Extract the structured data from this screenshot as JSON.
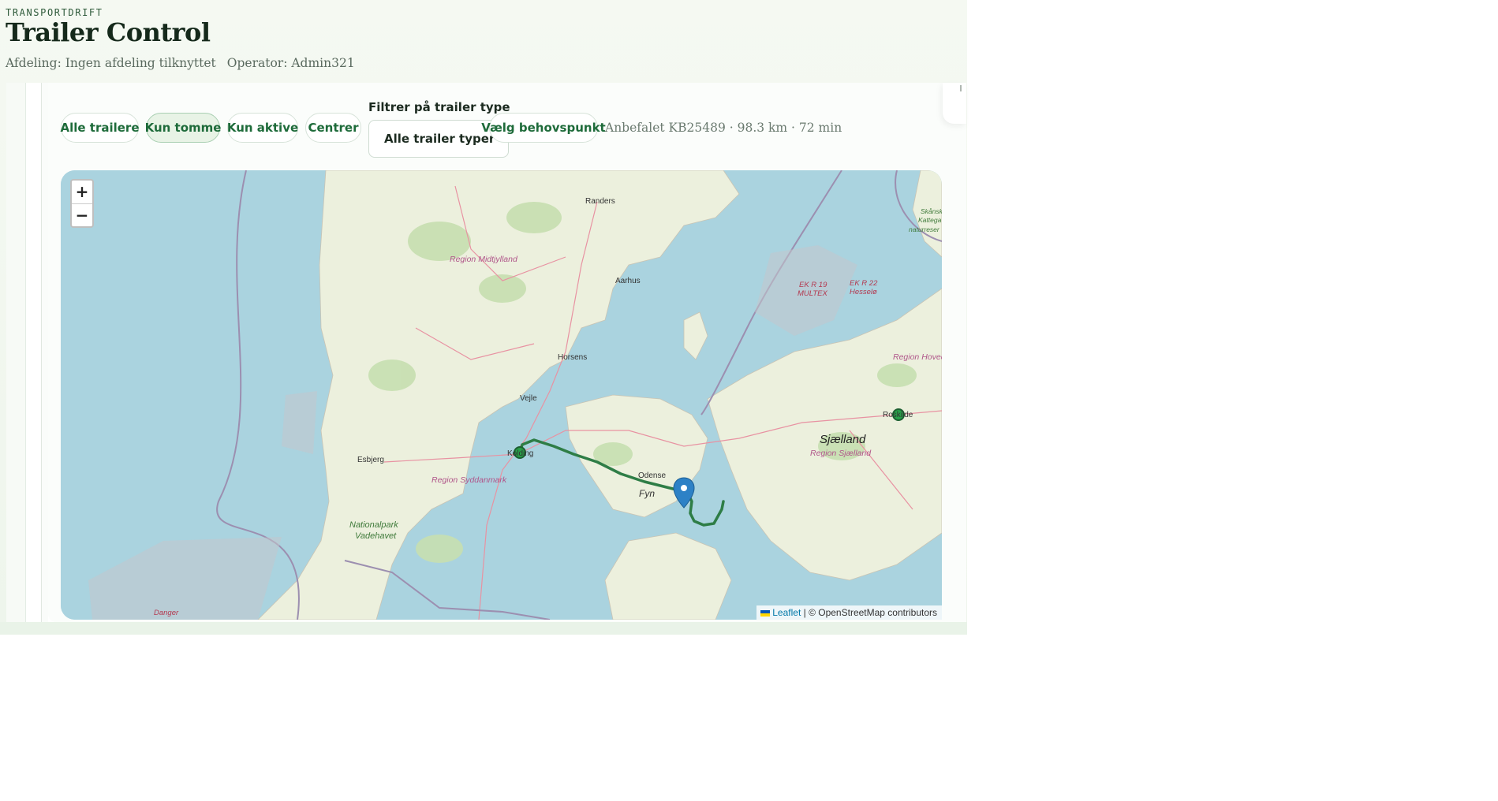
{
  "header": {
    "eyebrow": "TRANSPORTDRIFT",
    "title": "Trailer Control",
    "department": "Afdeling: Ingen afdeling tilknyttet",
    "operator": "Operator: Admin321"
  },
  "toolbar": {
    "chips": {
      "all": "Alle trailere",
      "empty": "Kun tomme",
      "active": "Kun aktive",
      "centers": "Centrer",
      "need_point": "Vælg behovspunkt"
    },
    "active_chip": "empty",
    "filter_label": "Filtrer på trailer type",
    "trailer_type_selected": "Alle trailer typer",
    "recommendation": "Anbefalet KB25489 · 98.3 km · 72 min"
  },
  "map": {
    "zoom_in": "+",
    "zoom_out": "−",
    "attribution_link": "Leaflet",
    "attribution_text": "| © OpenStreetMap contributors",
    "places": {
      "randers": "Randers",
      "aarhus": "Aarhus",
      "horsens": "Horsens",
      "vejle": "Vejle",
      "kolding": "Kolding",
      "esbjerg": "Esbjerg",
      "odense": "Odense",
      "roskilde": "Roskilde",
      "fyn": "Fyn",
      "sjaelland": "Sjælland",
      "region_midt": "Region Midtjylland",
      "region_syd": "Region Syddanmark",
      "region_sjaelland": "Region Sjælland",
      "region_hoved": "Region Hoved",
      "park1": "Nationalpark",
      "park2": "Vadehavet",
      "skane1": "Skånsk",
      "skane2": "Kattega",
      "skane3": "naturreser",
      "ekr19a": "EK R 19",
      "ekr19b": "MULTEX",
      "ekr22a": "EK R 22",
      "ekr22b": "Hesselø",
      "danger": "Danger"
    },
    "colors": {
      "sea": "#aad3df",
      "land": "#f2efe9",
      "route": "#2e7d46",
      "marker": "#2d81c6",
      "trailer_dot": "#27a048"
    }
  }
}
